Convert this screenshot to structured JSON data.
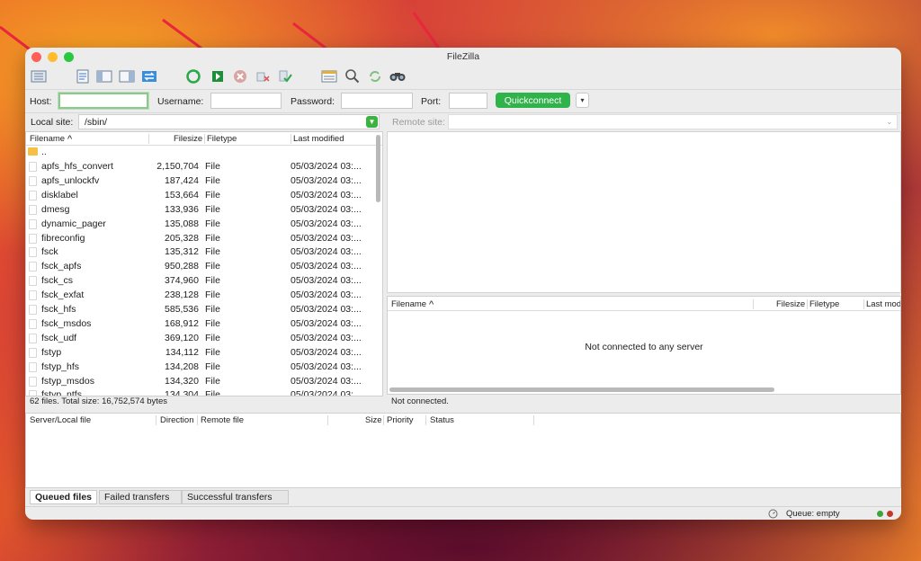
{
  "window": {
    "title": "FileZilla"
  },
  "toolbar": {
    "icons": [
      "site-manager-icon",
      "message-log-icon",
      "local-tree-icon",
      "remote-tree-icon",
      "transfer-queue-icon",
      "refresh-icon",
      "process-queue-icon",
      "cancel-icon",
      "disconnect-icon",
      "reconnect-icon",
      "filter-icon",
      "compare-icon",
      "sync-browse-icon",
      "search-icon"
    ]
  },
  "quickconnect": {
    "host_label": "Host:",
    "host_value": "",
    "username_label": "Username:",
    "username_value": "",
    "password_label": "Password:",
    "password_value": "",
    "port_label": "Port:",
    "port_value": "",
    "button_label": "Quickconnect",
    "dropdown_icon": "▾"
  },
  "local": {
    "site_label": "Local site:",
    "site_path": "/sbin/",
    "columns": {
      "filename": "Filename",
      "filesize": "Filesize",
      "filetype": "Filetype",
      "modified": "Last modified"
    },
    "sort_icon": "^",
    "parent_dir": "..",
    "files": [
      {
        "name": "apfs_hfs_convert",
        "size": "2,150,704",
        "type": "File",
        "modified": "05/03/2024 03:..."
      },
      {
        "name": "apfs_unlockfv",
        "size": "187,424",
        "type": "File",
        "modified": "05/03/2024 03:..."
      },
      {
        "name": "disklabel",
        "size": "153,664",
        "type": "File",
        "modified": "05/03/2024 03:..."
      },
      {
        "name": "dmesg",
        "size": "133,936",
        "type": "File",
        "modified": "05/03/2024 03:..."
      },
      {
        "name": "dynamic_pager",
        "size": "135,088",
        "type": "File",
        "modified": "05/03/2024 03:..."
      },
      {
        "name": "fibreconfig",
        "size": "205,328",
        "type": "File",
        "modified": "05/03/2024 03:..."
      },
      {
        "name": "fsck",
        "size": "135,312",
        "type": "File",
        "modified": "05/03/2024 03:..."
      },
      {
        "name": "fsck_apfs",
        "size": "950,288",
        "type": "File",
        "modified": "05/03/2024 03:..."
      },
      {
        "name": "fsck_cs",
        "size": "374,960",
        "type": "File",
        "modified": "05/03/2024 03:..."
      },
      {
        "name": "fsck_exfat",
        "size": "238,128",
        "type": "File",
        "modified": "05/03/2024 03:..."
      },
      {
        "name": "fsck_hfs",
        "size": "585,536",
        "type": "File",
        "modified": "05/03/2024 03:..."
      },
      {
        "name": "fsck_msdos",
        "size": "168,912",
        "type": "File",
        "modified": "05/03/2024 03:..."
      },
      {
        "name": "fsck_udf",
        "size": "369,120",
        "type": "File",
        "modified": "05/03/2024 03:..."
      },
      {
        "name": "fstyp",
        "size": "134,112",
        "type": "File",
        "modified": "05/03/2024 03:..."
      },
      {
        "name": "fstyp_hfs",
        "size": "134,208",
        "type": "File",
        "modified": "05/03/2024 03:..."
      },
      {
        "name": "fstyp_msdos",
        "size": "134,320",
        "type": "File",
        "modified": "05/03/2024 03:..."
      },
      {
        "name": "fstyp_ntfs",
        "size": "134,304",
        "type": "File",
        "modified": "05/03/2024 03:..."
      }
    ],
    "status": "62 files. Total size: 16,752,574 bytes"
  },
  "remote": {
    "site_label": "Remote site:",
    "site_path": "",
    "columns": {
      "filename": "Filename",
      "filesize": "Filesize",
      "filetype": "Filetype",
      "modified": "Last mod"
    },
    "sort_icon": "^",
    "empty_message": "Not connected to any server",
    "status": "Not connected."
  },
  "queue": {
    "columns": {
      "server_local": "Server/Local file",
      "direction": "Direction",
      "remote_file": "Remote file",
      "size": "Size",
      "priority": "Priority",
      "status": "Status"
    },
    "tabs": [
      "Queued files",
      "Failed transfers",
      "Successful transfers"
    ],
    "status": "Queue: empty"
  },
  "colors": {
    "accent_green": "#2fb34a",
    "focus_ring": "#8ec88f",
    "arrow_red": "#e8273c"
  }
}
